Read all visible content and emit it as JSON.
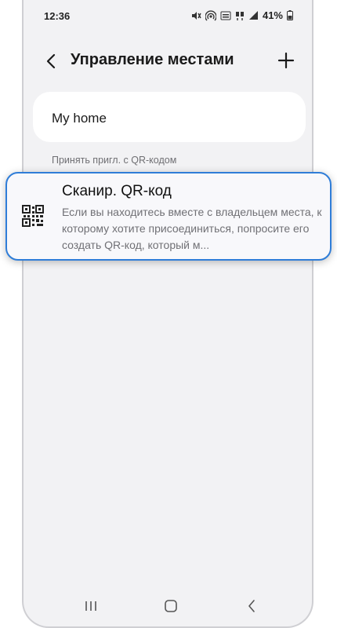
{
  "status": {
    "time": "12:36",
    "battery": "41%",
    "icons": [
      "mute-icon",
      "hotspot-icon",
      "volte-icon",
      "4g-icon",
      "signal-icon",
      "battery-icon"
    ]
  },
  "header": {
    "title": "Управление местами",
    "back_icon": "chevron-left-icon",
    "add_icon": "plus-icon"
  },
  "places": {
    "home_label": "My home"
  },
  "section": {
    "label": "Принять пригл. с QR-кодом"
  },
  "qr_card": {
    "icon": "qr-code-icon",
    "title": "Сканир. QR-код",
    "description": "Если вы находитесь вместе с владельцем места, к которому хотите присоединиться, попросите его создать QR-код, который м..."
  },
  "navbar": {
    "icons": [
      "recents-icon",
      "home-icon",
      "back-icon"
    ]
  },
  "colors": {
    "highlight_border": "#2f7dd8",
    "background": "#f2f2f4",
    "card": "#ffffff"
  }
}
